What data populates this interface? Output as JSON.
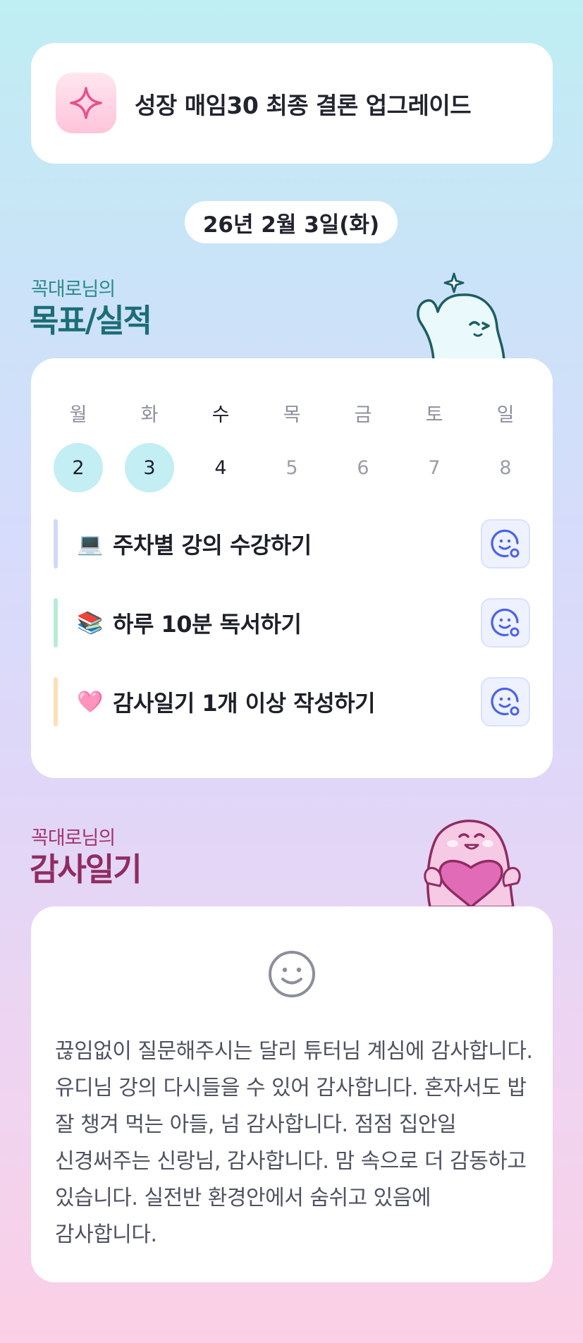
{
  "banner": {
    "title": "성장 매임30 최종 결론 업그레이드",
    "icon": "sparkle-icon",
    "accent": "#f0679e"
  },
  "date": "26년 2월 3일(화)",
  "goals_section": {
    "subtitle": "꼭대로님의",
    "title": "목표/실적"
  },
  "week": {
    "days": [
      {
        "label": "월",
        "num": "2",
        "state": "done"
      },
      {
        "label": "화",
        "num": "3",
        "state": "done"
      },
      {
        "label": "수",
        "num": "4",
        "state": "today"
      },
      {
        "label": "목",
        "num": "5",
        "state": "future"
      },
      {
        "label": "금",
        "num": "6",
        "state": "future"
      },
      {
        "label": "토",
        "num": "7",
        "state": "future"
      },
      {
        "label": "일",
        "num": "8",
        "state": "future"
      }
    ]
  },
  "goals": [
    {
      "emoji": "💻",
      "text": "주차별 강의 수강하기",
      "bar_color": "#d2d8f7"
    },
    {
      "emoji": "📚",
      "text": "하루 10분 독서하기",
      "bar_color": "#b9ecd8"
    },
    {
      "emoji": "🩷",
      "text": "감사일기 1개 이상 작성하기",
      "bar_color": "#fde0b8"
    }
  ],
  "thanks_section": {
    "subtitle": "꼭대로님의",
    "title": "감사일기",
    "text": "끊임없이 질문해주시는 달리 튜터님 계심에 감사합니다. 유디님 강의 다시들을 수 있어 감사합니다. 혼자서도 밥 잘 챙겨 먹는 아들, 넘 감사합니다. 점점 집안일 신경써주는 신랑님, 감사합니다. 맘 속으로 더 감동하고 있습니다. 실전반 환경안에서 숨쉬고 있음에 감사합니다."
  },
  "colors": {
    "done_day": "#c3eef3",
    "goal_title": "#1c6d77",
    "thanks_title": "#8f2c62",
    "button_blue": "#4a63e8"
  }
}
